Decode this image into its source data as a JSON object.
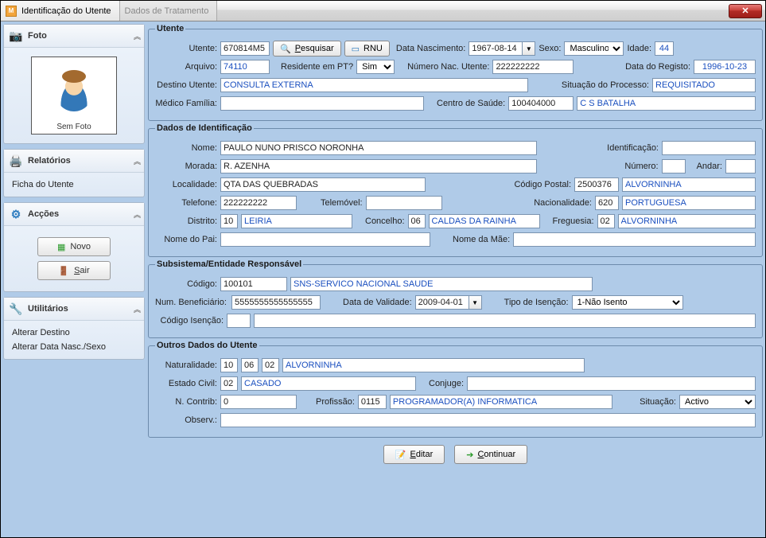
{
  "window": {
    "title": "Identificação do Utente",
    "tab2": "Dados de Tratamento"
  },
  "sidebar": {
    "foto": {
      "title": "Foto",
      "caption": "Sem Foto"
    },
    "relatorios": {
      "title": "Relatórios",
      "items": [
        "Ficha do Utente"
      ]
    },
    "accoes": {
      "title": "Acções",
      "novo": "Novo",
      "sair": "Sair"
    },
    "utilitarios": {
      "title": "Utilitários",
      "items": [
        "Alterar Destino",
        "Alterar Data Nasc./Sexo"
      ]
    }
  },
  "utente": {
    "legend": "Utente",
    "lbl_utente": "Utente:",
    "utente": "670814M5",
    "btn_pesquisar": "Pesquisar",
    "btn_rnu": "RNU",
    "lbl_nasc": "Data Nascimento:",
    "nasc": "1967-08-14",
    "lbl_sexo": "Sexo:",
    "sexo": "Masculino",
    "lbl_idade": "Idade:",
    "idade": "44",
    "lbl_arquivo": "Arquivo:",
    "arquivo": "74110",
    "lbl_res": "Residente em PT?",
    "residente": "Sim",
    "lbl_num_nac": "Número Nac. Utente:",
    "num_nac": "222222222",
    "lbl_data_reg": "Data do Registo:",
    "data_reg": "1996-10-23",
    "lbl_destino": "Destino Utente:",
    "destino": "CONSULTA EXTERNA",
    "lbl_sit": "Situação do Processo:",
    "situacao": "REQUISITADO",
    "lbl_medico": "Médico Família:",
    "medico": "",
    "lbl_centro": "Centro de Saúde:",
    "centro_cod": "100404000",
    "centro_nome": "C S BATALHA"
  },
  "ident": {
    "legend": "Dados de Identificação",
    "lbl_nome": "Nome:",
    "nome": "PAULO NUNO PRISCO NORONHA",
    "lbl_ident": "Identificação:",
    "ident": "",
    "lbl_morada": "Morada:",
    "morada": "R. AZENHA",
    "lbl_numero": "Número:",
    "numero": "",
    "lbl_andar": "Andar:",
    "andar": "",
    "lbl_local": "Localidade:",
    "local": "QTA DAS QUEBRADAS",
    "lbl_cp": "Código Postal:",
    "cp": "2500376",
    "cp_nome": "ALVORNINHA",
    "lbl_tel": "Telefone:",
    "tel": "222222222",
    "lbl_tlm": "Telemóvel:",
    "tlm": "",
    "lbl_nac": "Nacionalidade:",
    "nac_cod": "620",
    "nac_nome": "PORTUGUESA",
    "lbl_dist": "Distrito:",
    "dist_cod": "10",
    "dist_nome": "LEIRIA",
    "lbl_conc": "Concelho:",
    "conc_cod": "06",
    "conc_nome": "CALDAS DA RAINHA",
    "lbl_freg": "Freguesia:",
    "freg_cod": "02",
    "freg_nome": "ALVORNINHA",
    "lbl_pai": "Nome do Pai:",
    "pai": "",
    "lbl_mae": "Nome da Mãe:",
    "mae": ""
  },
  "sub": {
    "legend": "Subsistema/Entidade Responsável",
    "lbl_cod": "Código:",
    "cod": "100101",
    "nome": "SNS-SERVICO NACIONAL SAUDE",
    "lbl_benef": "Num. Beneficiário:",
    "benef": "5555555555555555",
    "lbl_val": "Data de Validade:",
    "val": "2009-04-01",
    "lbl_isen": "Tipo de Isenção:",
    "isen": "1-Não Isento",
    "lbl_cod_isen": "Código Isenção:",
    "cod_isen": ""
  },
  "outros": {
    "legend": "Outros Dados do Utente",
    "lbl_nat": "Naturalidade:",
    "nat1": "10",
    "nat2": "06",
    "nat3": "02",
    "nat_nome": "ALVORNINHA",
    "lbl_ec": "Estado Civil:",
    "ec_cod": "02",
    "ec_nome": "CASADO",
    "lbl_conj": "Conjuge:",
    "conj": "",
    "lbl_contrib": "N. Contrib:",
    "contrib": "0",
    "lbl_prof": "Profissão:",
    "prof_cod": "0115",
    "prof_nome": "PROGRAMADOR(A) INFORMATICA",
    "lbl_sit": "Situação:",
    "sit": "Activo",
    "lbl_obs": "Observ.:",
    "obs": ""
  },
  "footer": {
    "editar": "Editar",
    "continuar": "Continuar"
  }
}
